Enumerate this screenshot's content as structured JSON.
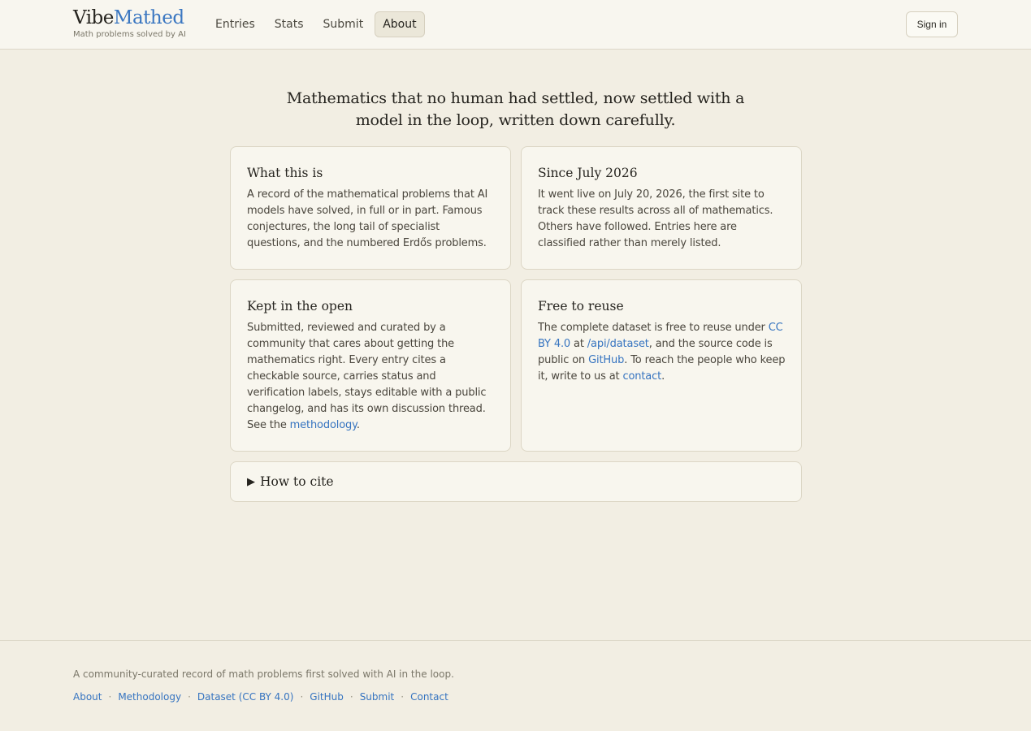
{
  "header": {
    "brand_part1": "Vibe",
    "brand_part2": "Mathed",
    "tagline": "Math problems solved by AI",
    "nav": [
      "Entries",
      "Stats",
      "Submit",
      "About"
    ],
    "active_nav": "About",
    "signin_label": "Sign in"
  },
  "hero": {
    "line1": "Mathematics that no human had settled, now settled with a",
    "line2": "model in the loop, written down carefully."
  },
  "cards": {
    "what": {
      "title": "What this is",
      "lines": [
        "A record of the mathematical problems that AI",
        "models have solved, in full or in part. Famous",
        "conjectures, the long tail of specialist",
        "questions, and the numbered Erdős problems."
      ]
    },
    "since": {
      "title": "Since July 2026",
      "lines": [
        "It went live on July 20, 2026, the first site to",
        "track these results across all of mathematics.",
        "Others have followed. Entries here are",
        "classified rather than merely listed."
      ]
    },
    "open": {
      "title": "Kept in the open",
      "lines": [
        "Submitted, reviewed and curated by a",
        "community that cares about getting the",
        "mathematics right. Every entry cites a",
        "checkable source, carries status and",
        "verification labels, stays editable with a public",
        "changelog, and has its own discussion thread."
      ],
      "last_prefix": "See the ",
      "last_link": "methodology",
      "last_suffix": "."
    },
    "reuse": {
      "title": "Free to reuse",
      "l1_text": "The complete dataset is free to reuse under ",
      "l1_link": "CC",
      "l2_link_a": "BY 4.0",
      "l2_mid": " at ",
      "l2_link_b": "/api/dataset",
      "l2_suffix": ", and the source code is",
      "l3_prefix": "public on ",
      "l3_link": "GitHub",
      "l3_suffix": ". To reach the people who keep",
      "l4_prefix": "it, write to us at ",
      "l4_link": "contact",
      "l4_suffix": "."
    }
  },
  "cite": {
    "icon": "triangle-right-icon",
    "label": "How to cite"
  },
  "footer": {
    "tagline": "A community-curated record of math problems first solved with AI in the loop.",
    "links": [
      "About",
      "Methodology",
      "Dataset (CC BY 4.0)",
      "GitHub",
      "Submit",
      "Contact"
    ],
    "separator": "·"
  },
  "colors": {
    "background": "#f2eee3",
    "card": "#f8f6ee",
    "accent": "#3b77c1",
    "link": "#3674c0"
  }
}
